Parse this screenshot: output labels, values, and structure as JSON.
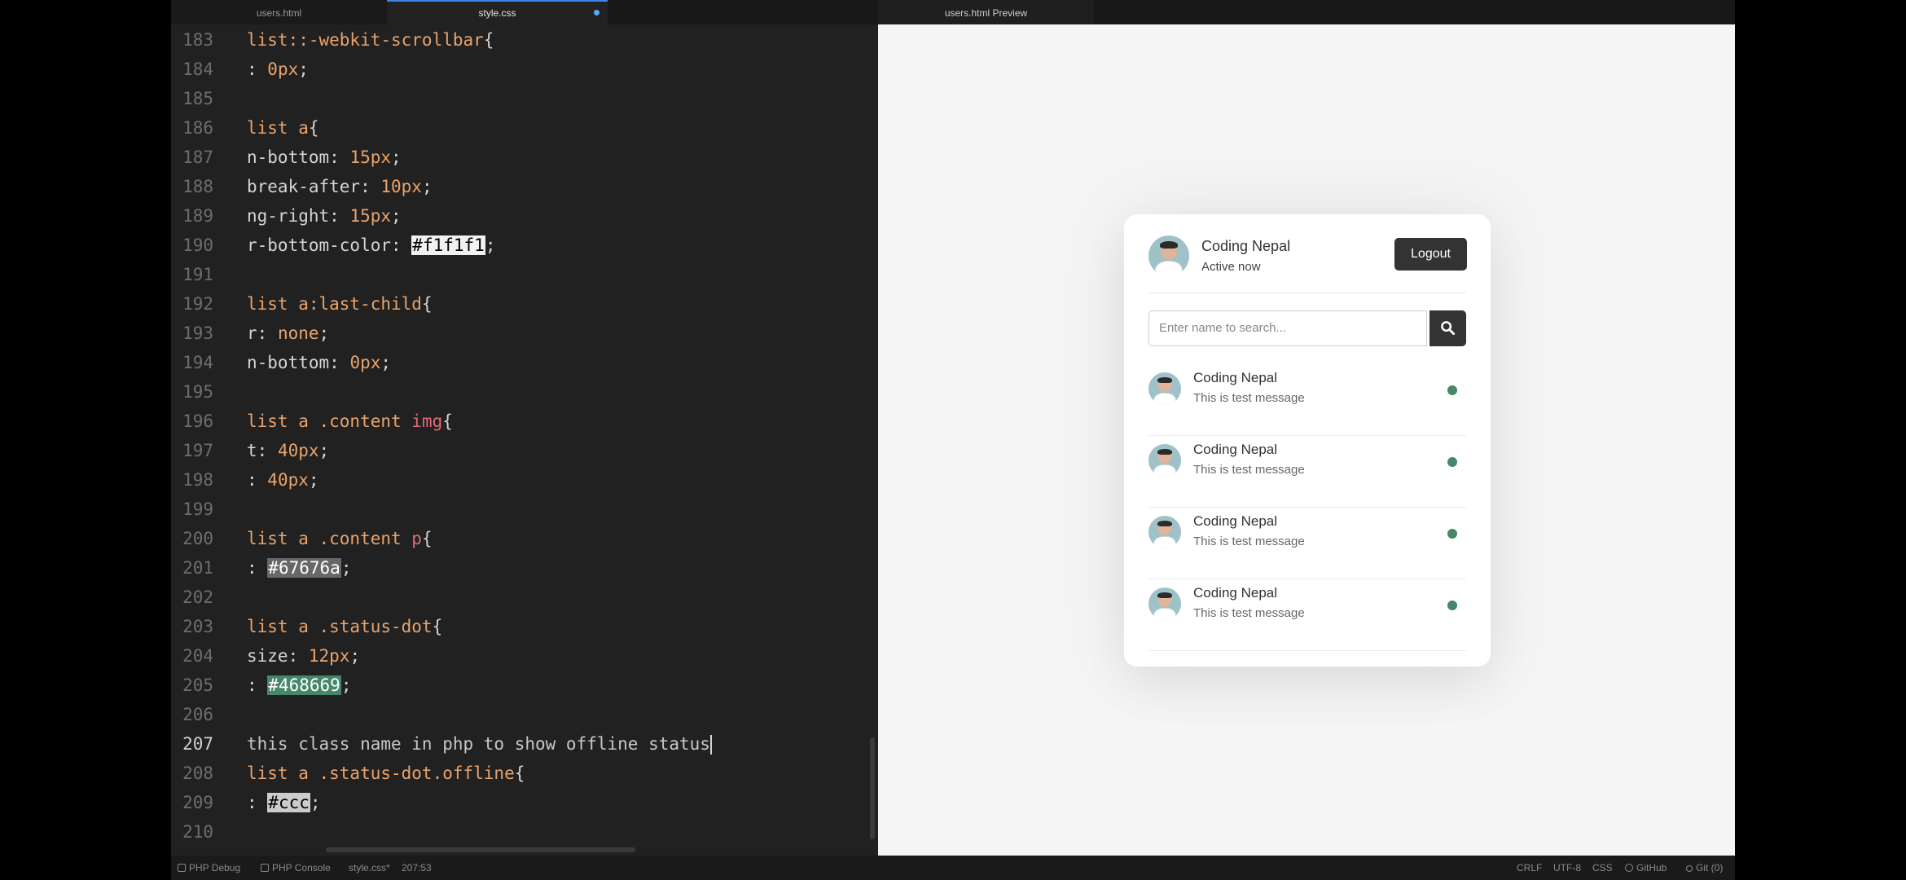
{
  "editor": {
    "tabs": [
      {
        "label": "users.html"
      },
      {
        "label": "style.css"
      }
    ],
    "lines": [
      {
        "n": "183",
        "a": "list::-webkit-scrollbar{",
        "s": "sel"
      },
      {
        "n": "184",
        "a": ": ",
        "b": "0px",
        "c": ";",
        "s": "num"
      },
      {
        "n": "185",
        "a": ""
      },
      {
        "n": "186",
        "a": "list a{",
        "s": "sel"
      },
      {
        "n": "187",
        "a": "n-bottom: ",
        "b": "15px",
        "c": ";",
        "s": "num"
      },
      {
        "n": "188",
        "a": "break-after: ",
        "b": "10px",
        "c": ";",
        "s": "num"
      },
      {
        "n": "189",
        "a": "ng-right: ",
        "b": "15px",
        "c": ";",
        "s": "num"
      },
      {
        "n": "190",
        "a": "r-bottom-color: ",
        "b": "#f1f1f1",
        "c": ";",
        "s": "swatch-light"
      },
      {
        "n": "191",
        "a": ""
      },
      {
        "n": "192",
        "a": "list a:last-child{",
        "s": "sel"
      },
      {
        "n": "193",
        "a": "r: ",
        "b": "none",
        "c": ";",
        "s": "num"
      },
      {
        "n": "194",
        "a": "n-bottom: ",
        "b": "0px",
        "c": ";",
        "s": "num"
      },
      {
        "n": "195",
        "a": ""
      },
      {
        "n": "196",
        "a": "list a .content img{",
        "s": "sel"
      },
      {
        "n": "197",
        "a": "t: ",
        "b": "40px",
        "c": ";",
        "s": "num"
      },
      {
        "n": "198",
        "a": ": ",
        "b": "40px",
        "c": ";",
        "s": "num"
      },
      {
        "n": "199",
        "a": ""
      },
      {
        "n": "200",
        "a": "list a .content p{",
        "s": "sel"
      },
      {
        "n": "201",
        "a": ": ",
        "b": "#67676a",
        "c": ";",
        "s": "swatch-gray"
      },
      {
        "n": "202",
        "a": ""
      },
      {
        "n": "203",
        "a": "list a .status-dot{",
        "s": "sel"
      },
      {
        "n": "204",
        "a": "size: ",
        "b": "12px",
        "c": ";",
        "s": "num"
      },
      {
        "n": "205",
        "a": ": ",
        "b": "#468669",
        "c": ";",
        "s": "swatch-green"
      },
      {
        "n": "206",
        "a": ""
      },
      {
        "n": "207",
        "a": "this class name in php to show offline status",
        "s": "comment",
        "cursor": true
      },
      {
        "n": "208",
        "a": "list a .status-dot.offline{",
        "s": "sel"
      },
      {
        "n": "209",
        "a": ": ",
        "b": "#ccc",
        "c": ";",
        "s": "swatch-ccc"
      },
      {
        "n": "210",
        "a": ""
      }
    ]
  },
  "preview": {
    "tab_label": "users.html Preview",
    "header": {
      "name": "Coding Nepal",
      "status": "Active now",
      "logout_label": "Logout"
    },
    "search": {
      "placeholder": "Enter name to search..."
    },
    "users": [
      {
        "name": "Coding Nepal",
        "message": "This is test message",
        "status": "online"
      },
      {
        "name": "Coding Nepal",
        "message": "This is test message",
        "status": "online"
      },
      {
        "name": "Coding Nepal",
        "message": "This is test message",
        "status": "online"
      },
      {
        "name": "Coding Nepal",
        "message": "This is test message",
        "status": "online"
      }
    ],
    "colors": {
      "status_dot": "#468669",
      "message_text": "#67676a",
      "button_bg": "#333333"
    }
  },
  "statusbar": {
    "php_debug": "PHP Debug",
    "php_console": "PHP Console",
    "file": "style.css*",
    "position": "207:53",
    "eol": "CRLF",
    "encoding": "UTF-8",
    "language": "CSS",
    "github": "GitHub",
    "git": "Git (0)"
  }
}
